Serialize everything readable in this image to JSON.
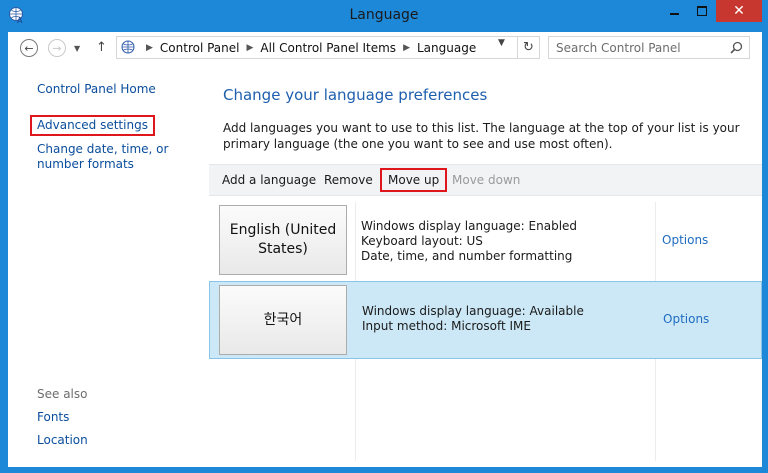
{
  "window": {
    "title": "Language",
    "close_glyph": "✕"
  },
  "address": {
    "crumbs": [
      "Control Panel",
      "All Control Panel Items",
      "Language"
    ],
    "search_placeholder": "Search Control Panel"
  },
  "sidebar": {
    "home": "Control Panel Home",
    "advanced": "Advanced settings",
    "date_time": "Change date, time, or number formats",
    "see_also": "See also",
    "fonts": "Fonts",
    "location": "Location"
  },
  "main": {
    "heading": "Change your language preferences",
    "description": "Add languages you want to use to this list. The language at the top of your list is your primary language (the one you want to see and use most often).",
    "toolbar": {
      "add": "Add a language",
      "remove": "Remove",
      "move_up": "Move up",
      "move_down": "Move down"
    },
    "languages": [
      {
        "name": "English (United States)",
        "lines": [
          "Windows display language: Enabled",
          "Keyboard layout: US",
          "Date, time, and number formatting"
        ],
        "options": "Options"
      },
      {
        "name": "한국어",
        "lines": [
          "Windows display language: Available",
          "Input method: Microsoft IME"
        ],
        "options": "Options"
      }
    ]
  },
  "colors": {
    "frame": "#1e88d8",
    "link": "#0a4d9c",
    "highlight_red": "#e0161d",
    "selected_row": "#cce8f6"
  }
}
